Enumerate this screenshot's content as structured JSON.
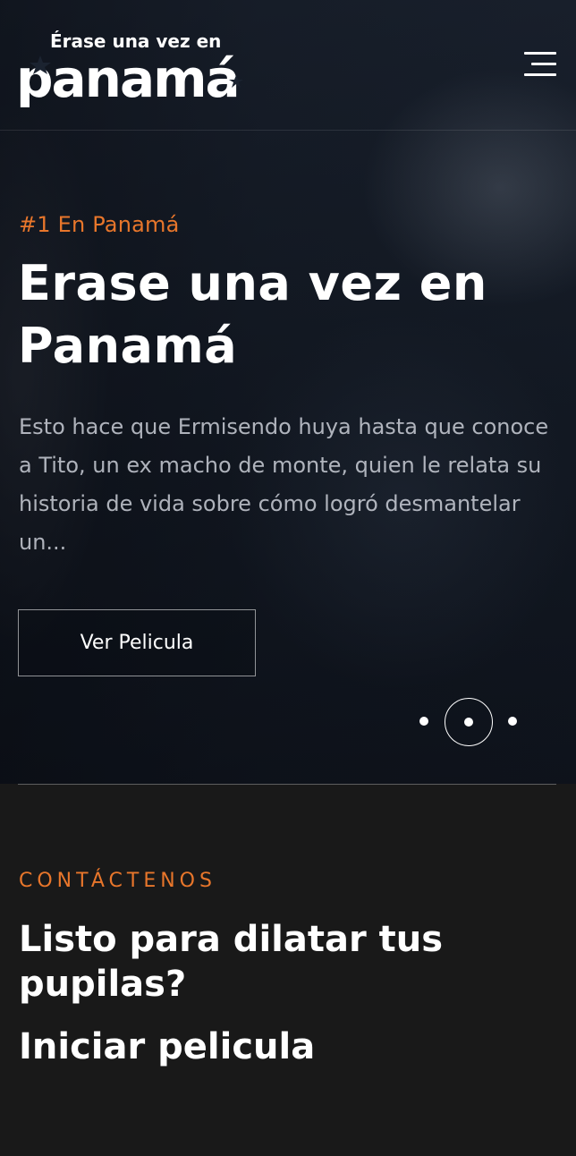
{
  "header": {
    "logo": {
      "top_text": "Érase una vez en",
      "big_text": "panamá"
    },
    "menu_icon": "hamburger-menu-icon"
  },
  "hero": {
    "eyebrow": "#1 En Panamá",
    "title": "Erase una vez en Panamá",
    "description": "Esto hace que Ermisendo huya hasta que conoce a Tito, un ex macho de monte, quien le relata su historia de vida sobre cómo logró desmantelar un...",
    "cta_label": "Ver Pelicula",
    "slides": {
      "count": 3,
      "active_index": 2
    }
  },
  "contact": {
    "eyebrow": "CONTÁCTENOS",
    "heading": "Listo para dilatar tus pupilas?",
    "link_label": "Iniciar pelicula"
  },
  "colors": {
    "accent": "#e8762b",
    "text": "#ffffff",
    "section_bg": "#191919"
  }
}
